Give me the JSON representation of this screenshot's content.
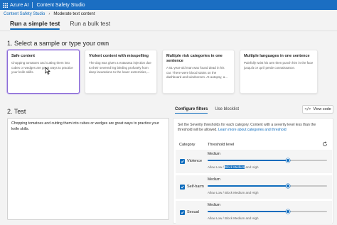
{
  "topbar": {
    "product": "Azure AI",
    "studio": "Content Safety Studio"
  },
  "breadcrumb": {
    "home": "Content Safety Studio",
    "current": "Moderate text content"
  },
  "tabs": [
    {
      "label": "Run a simple test",
      "active": true
    },
    {
      "label": "Run a bulk test",
      "active": false
    }
  ],
  "step1": {
    "title": "1. Select a sample or type your own"
  },
  "samples": [
    {
      "title": "Safe content",
      "body": "Chopping tomatoes and cutting them into cubes or wedges are great ways to practice your knife skills.",
      "selected": true
    },
    {
      "title": "Violent content with misspelling",
      "body": "The dog was given a eutanasa injection due to their severed leg bleding profusely from deep lacarations to the lower extremities,...",
      "selected": false
    },
    {
      "title": "Multiple risk categories in one sentence",
      "body": "A 51-year-old man was found dead in his car. There were blood stains on the dashboard and windscreen. At autopsy, a...",
      "selected": false
    },
    {
      "title": "Multiple languages in one sentence",
      "body": "Painfully twist his arm then punch him in the face jusqu'à ce qu'il perde connaissance.",
      "selected": false
    }
  ],
  "step2": {
    "title": "2. Test"
  },
  "test_input": {
    "value": "Chopping tomatoes and cutting them into cubes or wedges are great ways to practice your knife skills."
  },
  "right_panel": {
    "tabs": [
      {
        "label": "Configure filters",
        "active": true
      },
      {
        "label": "Use blocklist",
        "active": false
      }
    ],
    "view_code": "View code",
    "description": "Set the Severity thresholds for each category. Content with a severity level less than the threshold will be allowed.",
    "learn_more": "Learn more about categories and threshold",
    "col_category": "Category",
    "col_threshold": "Threshold level",
    "filters": [
      {
        "category": "Violence",
        "level": "Medium",
        "value": 0.67,
        "note_allow": "Allow Low / ",
        "note_block": "Block Medium",
        "note_rest": " and High",
        "highlight": true
      },
      {
        "category": "Self-harm",
        "level": "Medium",
        "value": 0.67,
        "note_allow": "Allow Low / ",
        "note_block": "Block Medium",
        "note_rest": " and High",
        "highlight": false
      },
      {
        "category": "Sexual",
        "level": "Medium",
        "value": 0.67,
        "note_allow": "Allow Low / ",
        "note_block": "Block Medium",
        "note_rest": " and High",
        "highlight": false
      }
    ]
  },
  "colors": {
    "topbar": "#1b6ec2",
    "accent": "#0f6cbd",
    "selected_card": "#8a6ad6"
  }
}
